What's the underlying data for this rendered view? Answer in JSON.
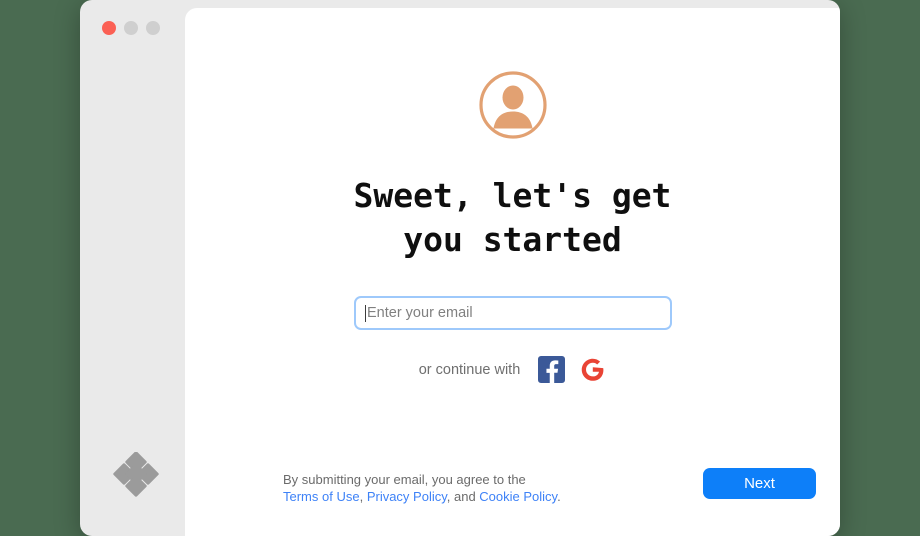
{
  "window": {
    "traffic_lights": [
      {
        "name": "close",
        "color": "#fb6054"
      },
      {
        "name": "minimize",
        "color": "#cfcfcf"
      },
      {
        "name": "zoom",
        "color": "#cfcfcf"
      }
    ],
    "background_color": "#4a6b51",
    "sidebar_color": "#eaeaea",
    "content_color": "#ffffff"
  },
  "sidebar": {
    "logo_name": "dropbox-logo",
    "logo_color": "#9b9b9b"
  },
  "main": {
    "avatar_icon": "user-avatar-icon",
    "avatar_color": "#e2a172",
    "heading": "Sweet, let's get\nyou started",
    "email_input": {
      "value": "",
      "placeholder": "Enter your email",
      "focused": true,
      "focus_ring_color": "#9ec9fb"
    },
    "continue_label": "or continue with",
    "social": [
      {
        "name": "facebook-login-button",
        "label": "Facebook",
        "color": "#3b5998"
      },
      {
        "name": "google-login-button",
        "label": "Google",
        "color": "#e94435"
      }
    ]
  },
  "footer": {
    "legal_prefix": "By submitting your email, you agree to the",
    "links": [
      {
        "label": "Terms of Use",
        "separator": ", "
      },
      {
        "label": "Privacy Policy",
        "separator": ", and "
      },
      {
        "label": "Cookie Policy",
        "separator": "."
      }
    ],
    "link_color": "#3e82f7",
    "next_label": "Next",
    "next_color": "#0d7ff9"
  }
}
